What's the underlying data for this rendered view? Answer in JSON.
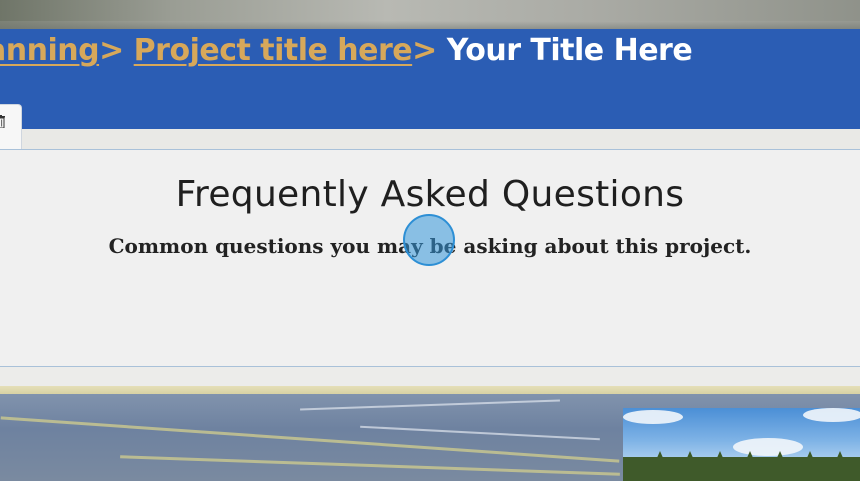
{
  "breadcrumb": {
    "items": [
      {
        "label": "anning",
        "link": true
      },
      {
        "label": "Project title here",
        "link": true
      }
    ],
    "separator": ">",
    "current": "Your Title Here"
  },
  "side_tab": {
    "icon": "trash-icon"
  },
  "faq": {
    "title": "Frequently Asked Questions",
    "subtitle": "Common questions you may be asking about this project."
  },
  "colors": {
    "banner": "#2b5db4",
    "breadcrumb_link": "#d7a85a",
    "breadcrumb_current": "#ffffff",
    "panel_bg": "#f0f0f0",
    "cursor": "#3498db"
  }
}
